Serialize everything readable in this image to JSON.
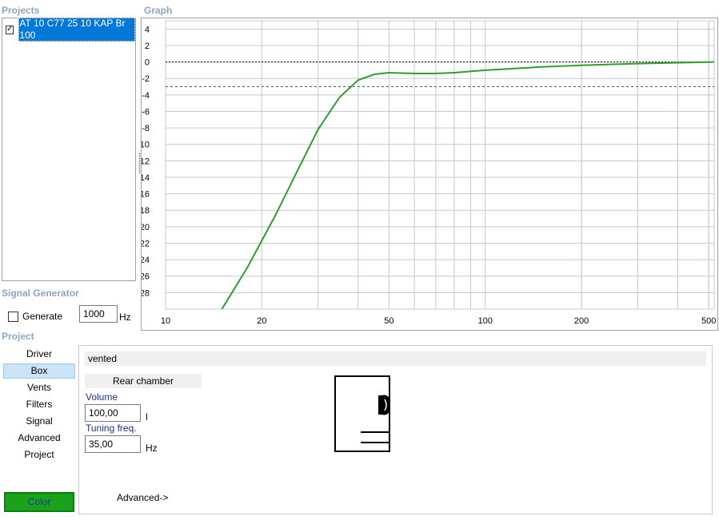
{
  "sections": {
    "projects": "Projects",
    "graph": "Graph",
    "signal_generator": "Signal Generator",
    "project": "Project"
  },
  "projects": [
    {
      "name": "AT 10 C77 25 10 KAP Br 100",
      "checked": true,
      "check_glyph": "✓"
    }
  ],
  "signal_generator": {
    "generate_label": "Generate",
    "generate_checked": false,
    "frequency": "1000",
    "frequency_unit": "Hz"
  },
  "nav": {
    "items": [
      "Driver",
      "Box",
      "Vents",
      "Filters",
      "Signal",
      "Advanced",
      "Project"
    ],
    "selected": "Box"
  },
  "color_button": {
    "label": "Color",
    "color": "#1aa31a"
  },
  "box": {
    "type": "vented",
    "rear_chamber": "Rear chamber",
    "volume_label": "Volume",
    "volume_value": "100,00",
    "volume_unit": "l",
    "tuning_label": "Tuning freq.",
    "tuning_value": "35,00",
    "tuning_unit": "Hz",
    "advanced_link": "Advanced->"
  },
  "chart_data": {
    "type": "line",
    "title": "",
    "xlabel": "",
    "ylabel": "",
    "x_scale": "log",
    "xlim": [
      10,
      520
    ],
    "ylim": [
      -30,
      5
    ],
    "x_ticks": [
      10,
      20,
      50,
      100,
      200,
      500
    ],
    "y_ticks": [
      4,
      2,
      0,
      -2,
      -4,
      -6,
      -8,
      -10,
      -12,
      -14,
      -16,
      -18,
      -20,
      -22,
      -24,
      -26,
      -28
    ],
    "reference_lines": [
      {
        "y": 0,
        "style": "dotted",
        "color": "#000000"
      },
      {
        "y": -3,
        "style": "dashed",
        "color": "#555555"
      }
    ],
    "grid": true,
    "series": [
      {
        "color": "#2ca02c",
        "x": [
          15,
          18,
          22,
          26,
          30,
          35,
          40,
          45,
          50,
          60,
          70,
          80,
          100,
          150,
          200,
          300,
          520
        ],
        "y": [
          -30,
          -25,
          -18.7,
          -13,
          -8.2,
          -4.3,
          -2.2,
          -1.5,
          -1.3,
          -1.4,
          -1.4,
          -1.3,
          -1.0,
          -0.6,
          -0.4,
          -0.2,
          0
        ]
      }
    ]
  }
}
